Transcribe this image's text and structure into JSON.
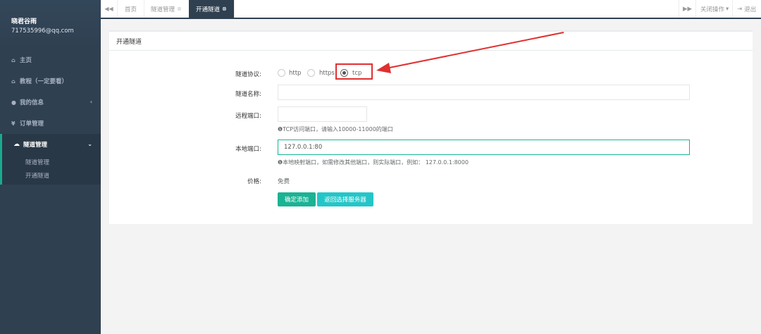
{
  "sidebar": {
    "profile_name": "晓君谷雨",
    "profile_email": "717535996@qq.com",
    "items": [
      {
        "icon": "home-icon",
        "glyph": "⌂",
        "label": "主页"
      },
      {
        "icon": "home-icon",
        "glyph": "⌂",
        "label": "教程（一定要看）"
      },
      {
        "icon": "user-icon",
        "glyph": "●",
        "label": "我的信息"
      },
      {
        "icon": "yen-icon",
        "glyph": "¥",
        "label": "订单管理"
      }
    ],
    "active_group": {
      "icon": "cloud-icon",
      "glyph": "☁",
      "label": "隧道管理"
    },
    "sub_items": [
      {
        "label": "隧道管理"
      },
      {
        "label": "开通隧道"
      }
    ]
  },
  "tabs": {
    "items": [
      {
        "label": "首页"
      },
      {
        "label": "隧道管理"
      },
      {
        "label": "开通隧道"
      }
    ],
    "close_ops": "关闭操作",
    "logout": "退出"
  },
  "panel": {
    "title": "开通隧道"
  },
  "form": {
    "protocol_label": "隧道协议:",
    "protocol_options": [
      "http",
      "https",
      "tcp"
    ],
    "protocol_selected": "tcp",
    "name_label": "隧道名称:",
    "name_value": "",
    "remote_port_label": "远程端口:",
    "remote_port_value": "",
    "remote_port_help": "TCP访问端口，请输入10000-11000的端口",
    "local_port_label": "本地端口:",
    "local_port_value": "127.0.0.1:80",
    "local_port_help": "本地映射端口，如需修改其他端口，则实际端口，例如：  127.0.0.1:8000",
    "price_label": "价格:",
    "price_value": "免费",
    "confirm_button": "确定添加",
    "back_button": "返回选择服务器"
  },
  "colors": {
    "sidebar_bg": "#2f4050",
    "primary": "#1ab394",
    "info": "#23c6c8",
    "annotation": "#e03030"
  }
}
